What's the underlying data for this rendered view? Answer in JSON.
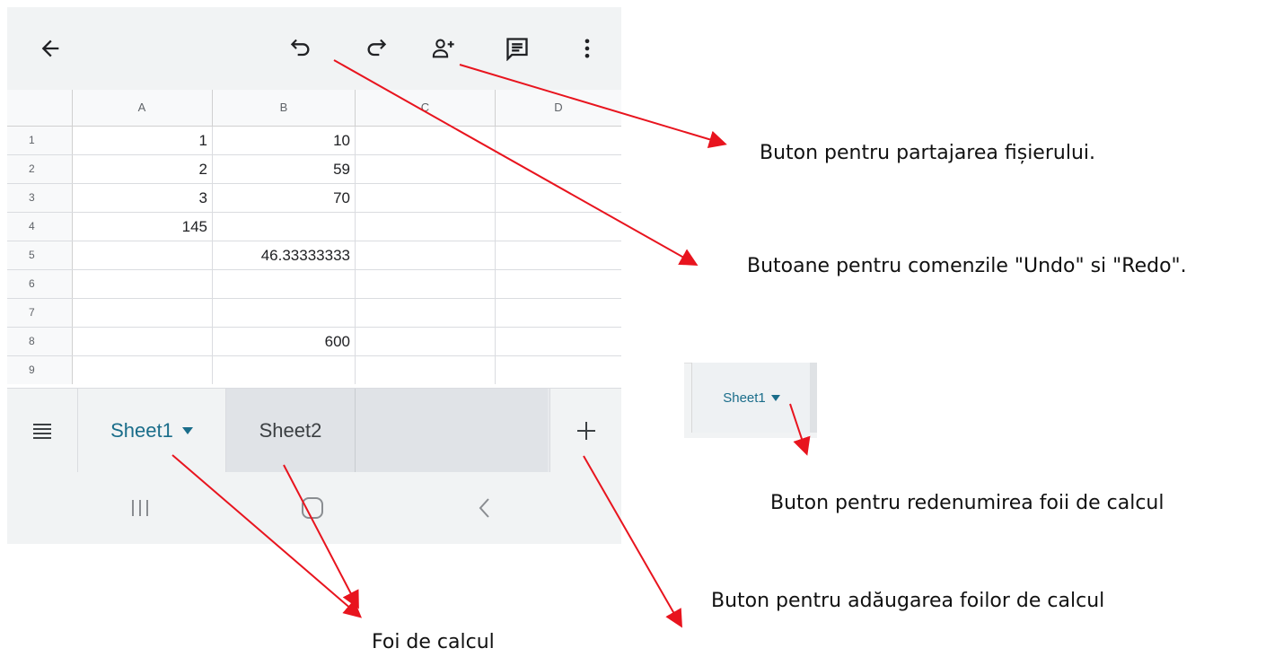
{
  "toolbar": {
    "icons": [
      "back-arrow-icon",
      "undo-icon",
      "redo-icon",
      "add-person-icon",
      "comment-icon",
      "more-vert-icon"
    ]
  },
  "grid": {
    "columns": [
      "A",
      "B",
      "C",
      "D"
    ],
    "rows": [
      {
        "num": "1",
        "a": "1",
        "b": "10"
      },
      {
        "num": "2",
        "a": "2",
        "b": "59"
      },
      {
        "num": "3",
        "a": "3",
        "b": "70"
      },
      {
        "num": "4",
        "a": "145",
        "b": ""
      },
      {
        "num": "5",
        "a": "",
        "b": "46.33333333"
      },
      {
        "num": "6",
        "a": "",
        "b": ""
      },
      {
        "num": "7",
        "a": "",
        "b": ""
      },
      {
        "num": "8",
        "a": "",
        "b": "600"
      },
      {
        "num": "9",
        "a": "",
        "b": ""
      }
    ]
  },
  "sheets": {
    "tab1": "Sheet1",
    "tab2": "Sheet2"
  },
  "zoom_inset": {
    "tab_label": "Sheet1"
  },
  "annotations": {
    "share": "Buton pentru partajarea fișierului.",
    "undo_redo": "Butoane pentru comenzile \"Undo\" si \"Redo\".",
    "rename": "Buton pentru redenumirea foii de calcul",
    "add_sheet": "Buton pentru adăugarea foilor de calcul",
    "sheets": "Foi de calcul"
  },
  "colors": {
    "arrow": "#e8141e",
    "active_tab": "#1a6d8a"
  }
}
